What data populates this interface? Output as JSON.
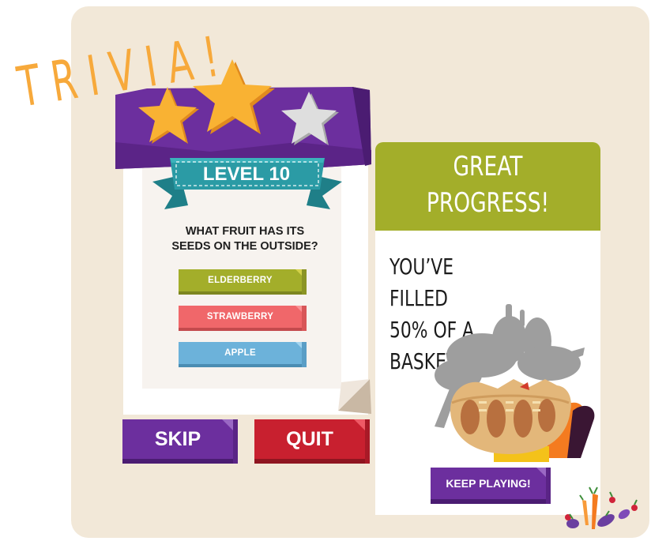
{
  "title": "TRIVIA!",
  "level": {
    "label": "LEVEL 10",
    "stars_earned": 2,
    "stars_total": 3
  },
  "question": "WHAT FRUIT HAS ITS\nSEEDS ON THE OUTSIDE?",
  "answers": [
    {
      "label": "ELDERBERRY",
      "color": "#a3ae2a"
    },
    {
      "label": "STRAWBERRY",
      "color": "#f0676a"
    },
    {
      "label": "APPLE",
      "color": "#6cb2da"
    }
  ],
  "buttons": {
    "skip": "SKIP",
    "quit": "QUIT",
    "keep_playing": "KEEP PLAYING!"
  },
  "progress": {
    "title": "GREAT\nPROGRESS!",
    "message": "YOU’VE FILLED\n50% OF A\nBASKET!",
    "basket_fill_percent": 50
  },
  "colors": {
    "background_panel": "#f2e8d8",
    "trivia_orange": "#f7a93b",
    "purple": "#6c2f9e",
    "teal_ribbon": "#2b9ba5",
    "star_gold": "#f9b233",
    "star_empty": "#d9d9d9",
    "progress_green": "#a3ae2a",
    "quit_red": "#c8202f"
  },
  "icons": [
    "star-icon",
    "basket-icon",
    "vegetables-logo-icon"
  ]
}
